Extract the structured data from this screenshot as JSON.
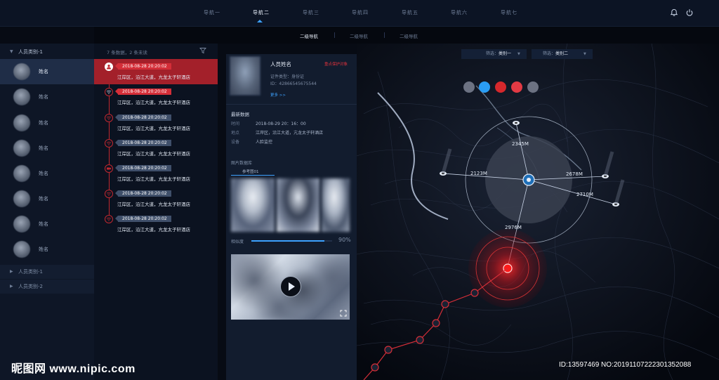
{
  "nav": {
    "items": [
      "导航一",
      "导航二",
      "导航三",
      "导航四",
      "导航五",
      "导航六",
      "导航七"
    ],
    "active_index": 1
  },
  "subnav": {
    "items": [
      "二级导航",
      "二级导航",
      "二级导航"
    ],
    "active_index": 0
  },
  "sidebar": {
    "categories": [
      {
        "label": "人员类别-1",
        "expanded": true
      },
      {
        "label": "人员类别-1",
        "expanded": false
      },
      {
        "label": "人员类别-2",
        "expanded": false
      }
    ],
    "persons": [
      "姓名",
      "姓名",
      "姓名",
      "姓名",
      "姓名",
      "姓名",
      "姓名",
      "姓名"
    ],
    "active_person": 0
  },
  "list": {
    "summary": "7 条数据，2 条未读",
    "records": [
      {
        "time": "2018-08-28  20:20:02",
        "address": "江岸区，沿江大道，亢龙太子轩酒店",
        "icon": "person-icon",
        "active": true
      },
      {
        "time": "2018-08-28  20:20:02",
        "address": "江岸区，沿江大道，亢龙太子轩酒店",
        "icon": "wifi-icon",
        "active": false,
        "unread": true
      },
      {
        "time": "2018-08-28  20:20:02",
        "address": "江岸区，沿江大道，亢龙太子轩酒店",
        "icon": "wifi-icon",
        "active": false
      },
      {
        "time": "2018-08-28  20:20:02",
        "address": "江岸区，沿江大道，亢龙太子轩酒店",
        "icon": "wifi-icon",
        "active": false
      },
      {
        "time": "2018-08-28  20:20:02",
        "address": "江岸区，沿江大道，亢龙太子轩酒店",
        "icon": "camera-icon",
        "active": false
      },
      {
        "time": "2018-08-28  20:20:02",
        "address": "江岸区，沿江大道，亢龙太子轩酒店",
        "icon": "wifi-icon",
        "active": false
      },
      {
        "time": "2018-08-28  20:20:02",
        "address": "江岸区，沿江大道，亢龙太子轩酒店",
        "icon": "wifi-icon",
        "active": false
      }
    ]
  },
  "detail": {
    "name": "人员姓名",
    "tag": "重点保护对象",
    "id_type": "证件类型：身份证",
    "id_number": "ID：42866545675544",
    "more": "更多 >>",
    "latest_title": "最新数据",
    "latest": [
      {
        "label": "时间",
        "value": "2018-08-29  20：16：00"
      },
      {
        "label": "地点",
        "value": "江岸区，沿江大道，亢龙太子轩酒店"
      },
      {
        "label": "设备",
        "value": "人脸监控"
      }
    ],
    "library_title": "图片数据库",
    "library_tab": "参考图01",
    "similarity_label": "相似度",
    "similarity_value": "90%",
    "similarity_fraction": 0.9
  },
  "map": {
    "filters": [
      {
        "label": "筛选：",
        "value": "类别一"
      },
      {
        "label": "筛选：",
        "value": "类别二"
      }
    ],
    "legend_colors": [
      "#6c7282",
      "#2a9df4",
      "#d6282c",
      "#e23a44",
      "#6c7282"
    ],
    "distances": [
      "2345M",
      "2123M",
      "2678M",
      "2710M",
      "2976M"
    ]
  },
  "watermark": {
    "left": "昵图网 www.nipic.com",
    "right": "ID:13597469 NO:20191107222301352088"
  }
}
